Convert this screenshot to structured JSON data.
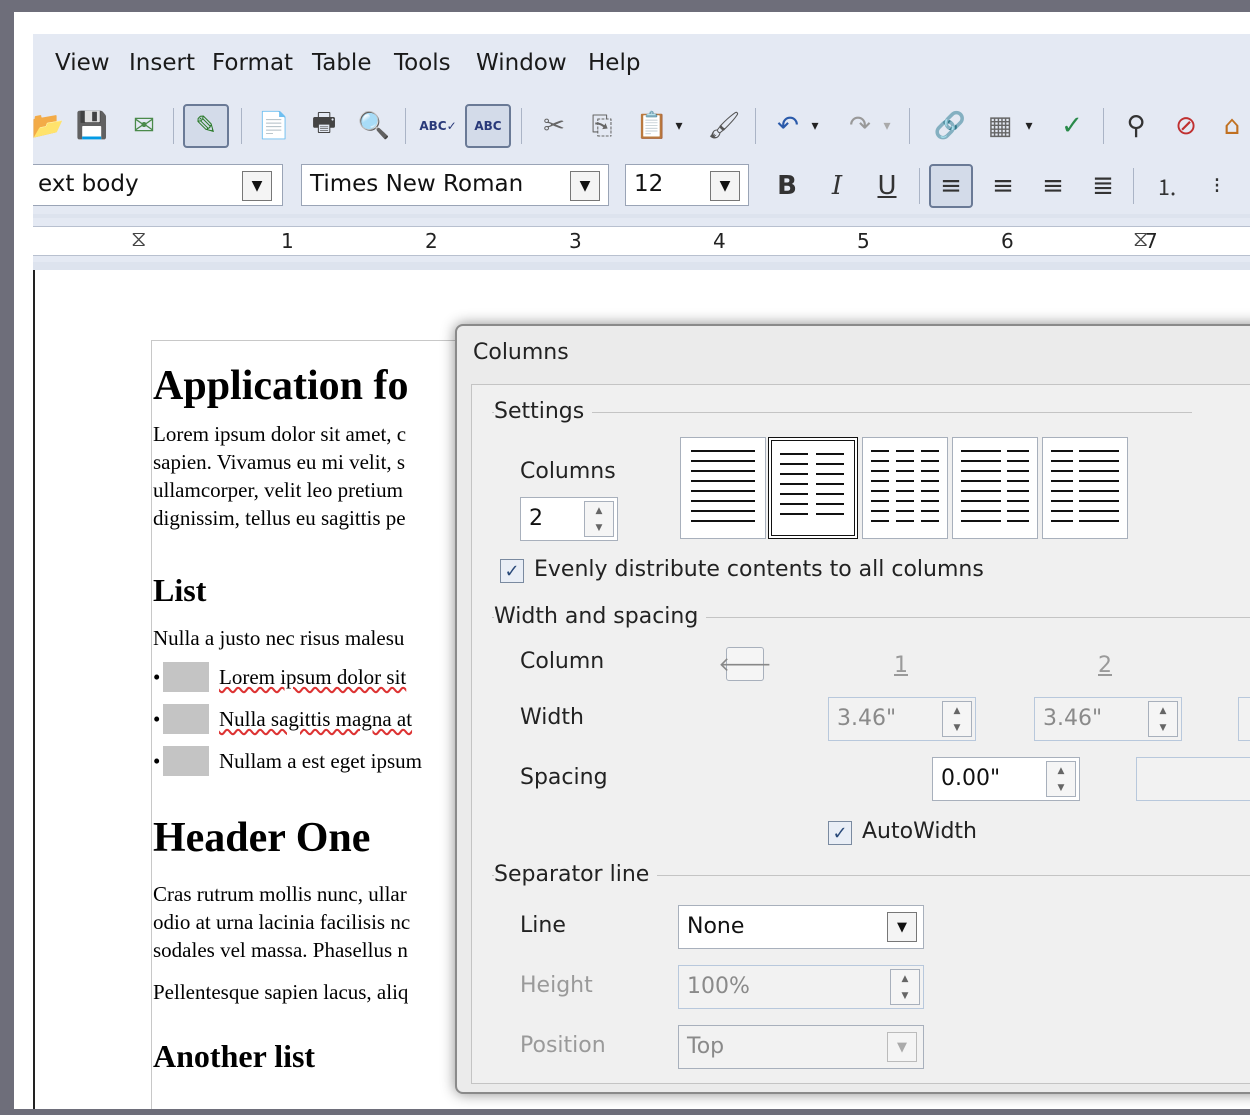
{
  "menu": {
    "items": [
      "View",
      "Insert",
      "Format",
      "Table",
      "Tools",
      "Window",
      "Help"
    ]
  },
  "format_bar": {
    "paragraph_style": "ext body",
    "font_name": "Times New Roman",
    "font_size": "12"
  },
  "ruler": {
    "numbers": [
      "1",
      "2",
      "3",
      "4",
      "5",
      "6",
      "7"
    ]
  },
  "document": {
    "title": "Application fo",
    "para1": [
      "Lorem ipsum dolor sit amet, c",
      "sapien. Vivamus eu mi velit, s",
      "ullamcorper, velit leo pretium",
      "dignissim, tellus eu sagittis pe"
    ],
    "list_heading": "List",
    "list_intro": "Nulla a justo nec risus malesu",
    "list_items": [
      "Lorem ipsum dolor sit",
      "Nulla sagittis magna at",
      "Nullam a est eget ipsum"
    ],
    "header_one": "Header One",
    "para2": [
      "Cras rutrum mollis nunc, ullar",
      "odio at urna lacinia facilisis nc",
      "sodales vel massa. Phasellus n"
    ],
    "para3": "Pellentesque sapien lacus, aliq",
    "another_list": "Another list"
  },
  "dialog": {
    "title": "Columns",
    "settings_label": "Settings",
    "columns_label": "Columns",
    "columns_value": "2",
    "evenly_label": "Evenly distribute contents to all columns",
    "evenly_checked": true,
    "width_spacing_label": "Width and spacing",
    "column_label": "Column",
    "col1": "1",
    "col2": "2",
    "width_label": "Width",
    "width1": "3.46\"",
    "width2": "3.46\"",
    "spacing_label": "Spacing",
    "spacing1": "0.00\"",
    "autowidth_label": "AutoWidth",
    "autowidth_checked": true,
    "separator_label": "Separator line",
    "line_label": "Line",
    "line_value": "None",
    "height_label": "Height",
    "height_value": "100%",
    "position_label": "Position",
    "position_value": "Top"
  }
}
